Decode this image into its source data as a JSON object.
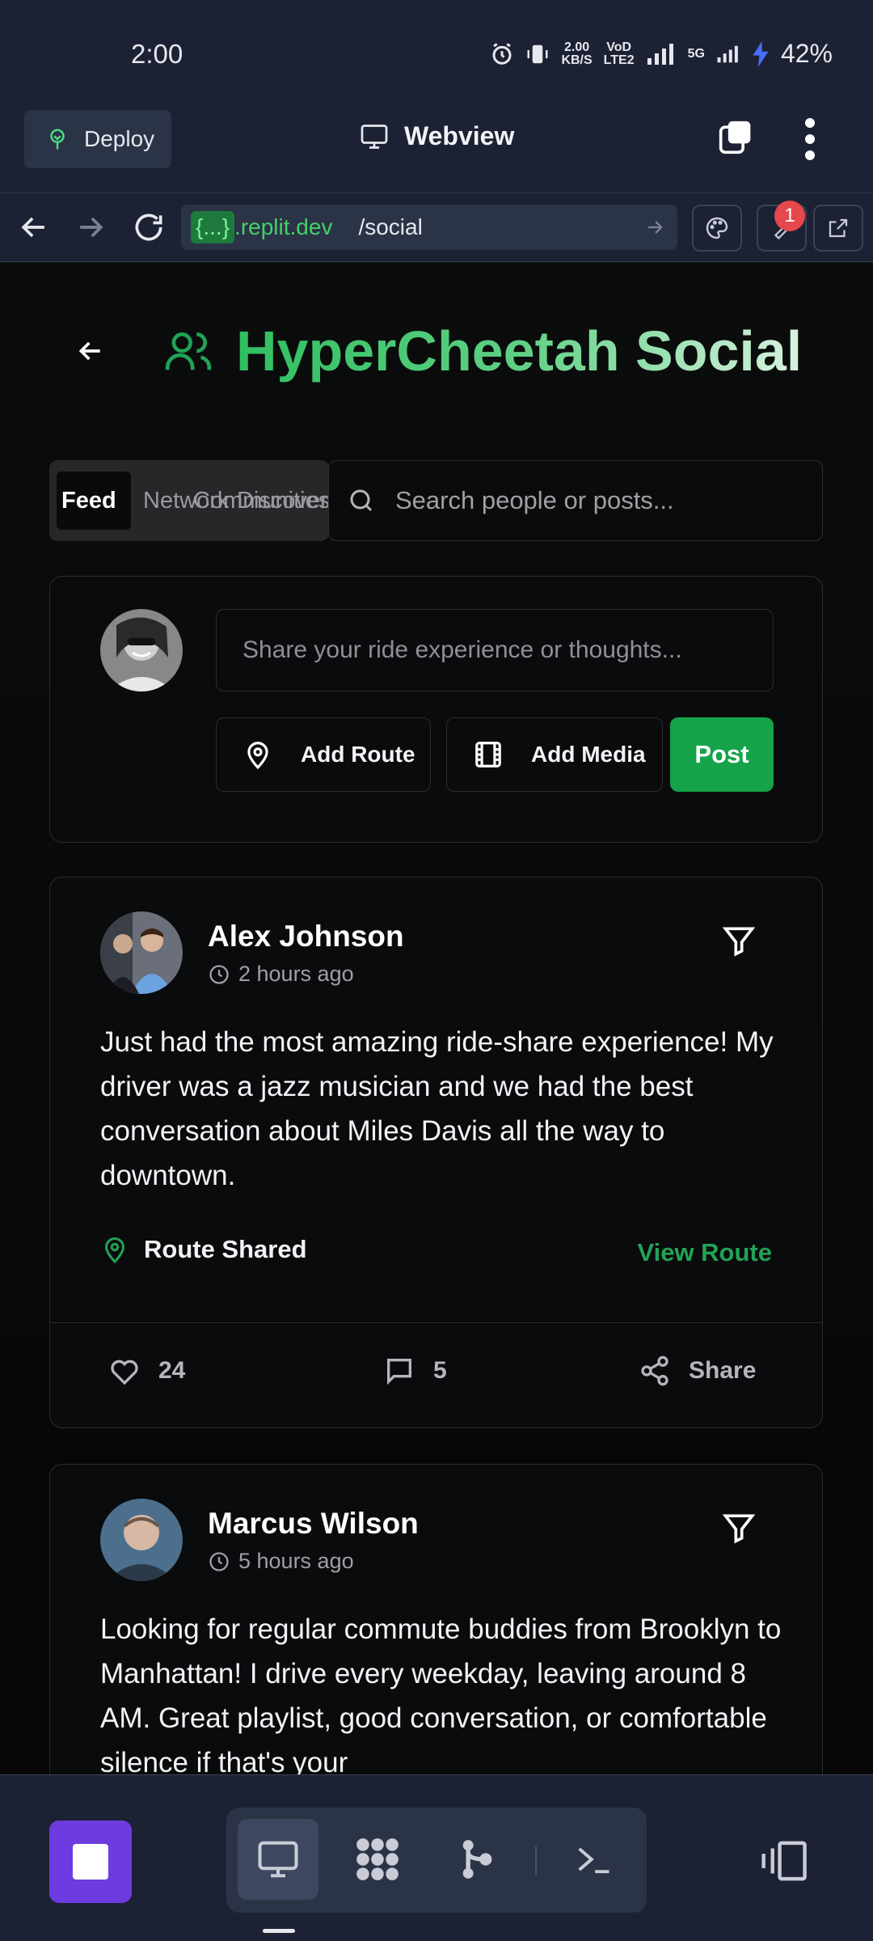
{
  "status": {
    "time": "2:00",
    "net_speed_top": "2.00",
    "net_speed_bottom": "KB/S",
    "volte_top": "VoD",
    "volte_bottom": "LTE2",
    "net_type": "5G",
    "battery": "42%"
  },
  "toolbar": {
    "deploy_label": "Deploy",
    "title": "Webview"
  },
  "urlbar": {
    "host_badge": "{...}",
    "host": ".replit.dev",
    "path": "/social",
    "notification_count": "1"
  },
  "page": {
    "title": "HyperCheetah Social",
    "tabs": [
      {
        "label": "Feed"
      },
      {
        "label": "Network"
      },
      {
        "label": "Communities"
      },
      {
        "label": "Discover"
      }
    ],
    "search_placeholder": "Search people or posts...",
    "composer": {
      "placeholder": "Share your ride experience or thoughts...",
      "add_route": "Add Route",
      "add_media": "Add Media",
      "post": "Post"
    },
    "posts": [
      {
        "author": "Alex Johnson",
        "time": "2 hours ago",
        "body": "Just had the most amazing ride-share experience! My driver was a jazz musician and we had the best conversation about Miles Davis all the way to downtown.",
        "route_label": "Route Shared",
        "view_route": "View Route",
        "likes": "24",
        "comments": "5",
        "share": "Share"
      },
      {
        "author": "Marcus Wilson",
        "time": "5 hours ago",
        "body": "Looking for regular commute buddies from Brooklyn to Manhattan! I drive every weekday, leaving around 8 AM. Great playlist, good conversation, or comfortable silence if that's your"
      }
    ]
  },
  "colors": {
    "accent": "#16a34a",
    "brand_purple": "#6d3be0",
    "chrome_bg": "#1c2233"
  }
}
